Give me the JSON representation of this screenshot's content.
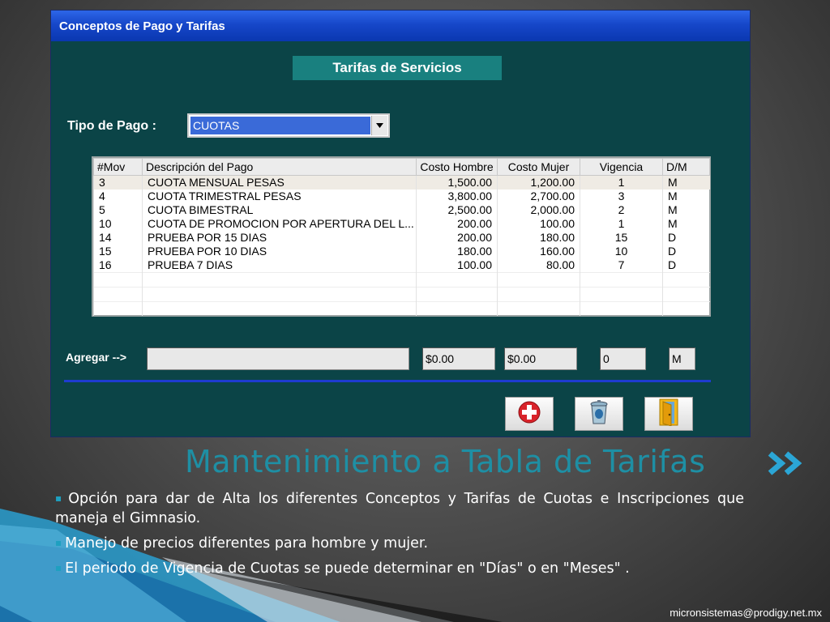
{
  "window": {
    "title": "Conceptos de Pago y Tarifas",
    "header": "Tarifas de Servicios",
    "tipo_pago_label": "Tipo de Pago :",
    "tipo_pago_value": "CUOTAS",
    "table": {
      "columns": [
        "#Mov",
        "Descripción del Pago",
        "Costo Hombre",
        "Costo Mujer",
        "Vigencia",
        "D/M"
      ],
      "rows": [
        [
          "3",
          "CUOTA MENSUAL PESAS",
          "1,500.00",
          "1,200.00",
          "1",
          "M"
        ],
        [
          "4",
          "CUOTA TRIMESTRAL PESAS",
          "3,800.00",
          "2,700.00",
          "3",
          "M"
        ],
        [
          "5",
          "CUOTA BIMESTRAL",
          "2,500.00",
          "2,000.00",
          "2",
          "M"
        ],
        [
          "10",
          "CUOTA DE PROMOCION POR APERTURA DEL L...",
          "200.00",
          "100.00",
          "1",
          "M"
        ],
        [
          "14",
          "PRUEBA POR 15 DIAS",
          "200.00",
          "180.00",
          "15",
          "D"
        ],
        [
          "15",
          "PRUEBA POR 10 DIAS",
          "180.00",
          "160.00",
          "10",
          "D"
        ],
        [
          "16",
          "PRUEBA 7 DIAS",
          "100.00",
          "80.00",
          "7",
          "D"
        ]
      ]
    },
    "agregar_label": "Agregar -->",
    "inputs": {
      "descripcion": "",
      "costo_hombre": "$0.00",
      "costo_mujer": "$0.00",
      "vigencia": "0",
      "dm": "M"
    },
    "buttons": [
      "add-icon",
      "delete-icon",
      "exit-door-icon"
    ]
  },
  "slide": {
    "title": "Mantenimiento a Tabla de Tarifas",
    "bullets": [
      "Opción para dar de Alta los diferentes Conceptos y Tarifas de Cuotas e Inscripciones que maneja el Gimnasio.",
      "Manejo de precios diferentes para hombre y mujer.",
      "El periodo de Vigencia de Cuotas se puede determinar en \"Días\" o en \"Meses\" ."
    ],
    "footer": "micronsistemas@prodigy.net.mx"
  },
  "colors": {
    "window_bg": "#0b4447",
    "titlebar": "#1647c9",
    "header_box": "#19807f",
    "slide_title": "#1e8fa4",
    "separator": "#1e3bd0"
  }
}
